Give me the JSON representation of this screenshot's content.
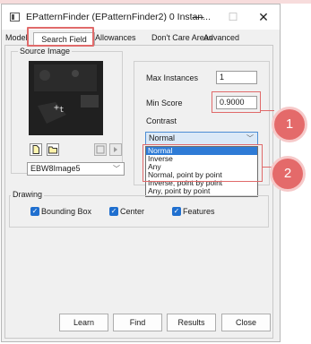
{
  "window": {
    "title": "EPatternFinder (EPatternFinder2) 0 Instan...",
    "minimize": "—",
    "maximize": "☐",
    "close": "✕"
  },
  "tabs": [
    "Model",
    "Search Field",
    "Allowances",
    "Don't Care Areas",
    "Advanced"
  ],
  "source": {
    "group_label": "Source Image",
    "image_combo": "EBW8Image5"
  },
  "params": {
    "max_instances_label": "Max Instances",
    "max_instances_value": "1",
    "min_score_label": "Min Score",
    "min_score_value": "0.9000",
    "contrast_label": "Contrast",
    "contrast_value": "Normal",
    "contrast_options": [
      "Normal",
      "Inverse",
      "Any",
      "Normal, point by point",
      "Inverse, point by point",
      "Any, point by point"
    ]
  },
  "drawing": {
    "group_label": "Drawing",
    "bounding_box": "Bounding Box",
    "center": "Center",
    "features": "Features"
  },
  "buttons": {
    "learn": "Learn",
    "find": "Find",
    "results": "Results",
    "close": "Close"
  },
  "callouts": [
    "1",
    "2"
  ],
  "colors": {
    "callout": "#e06a6a",
    "selection": "#2e7bd6",
    "checkbox": "#1f6fcf"
  },
  "icons": [
    "app-icon",
    "new-file-icon",
    "open-folder-icon",
    "prev-icon",
    "next-icon",
    "chevron-down-icon",
    "check-icon"
  ]
}
